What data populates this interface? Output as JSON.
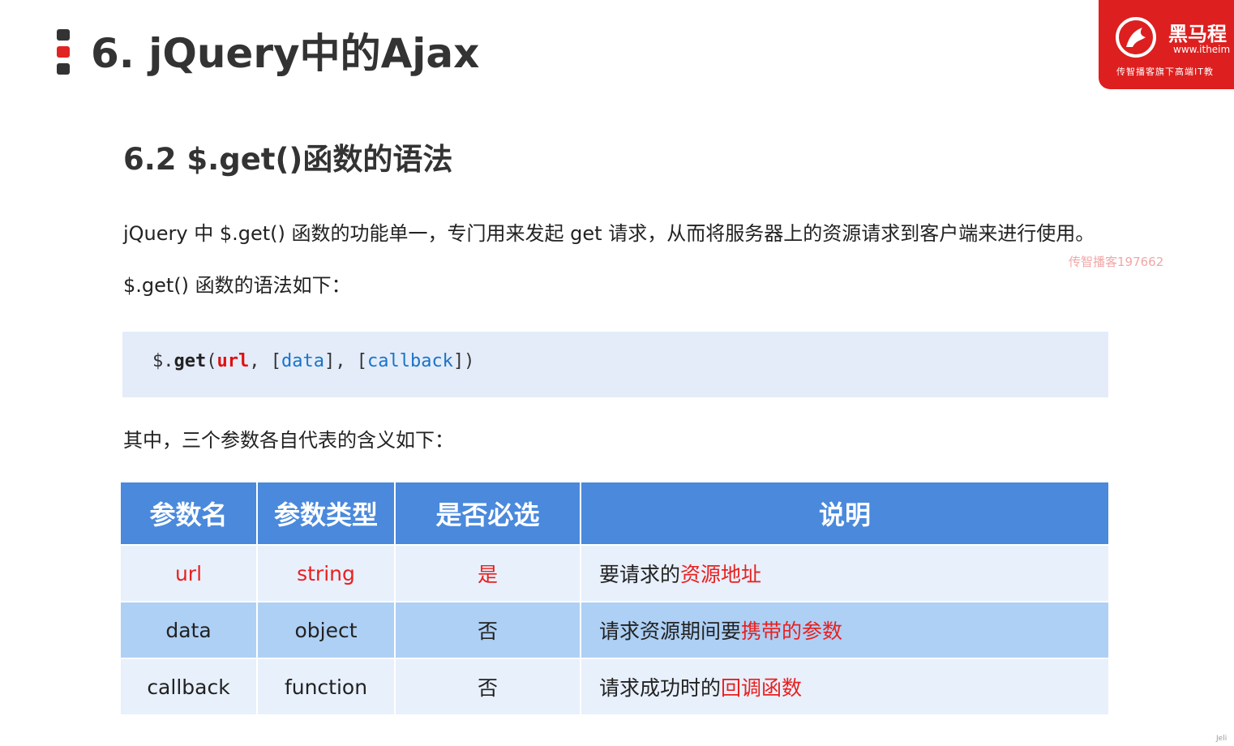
{
  "header": {
    "title": "6. jQuery中的Ajax"
  },
  "logo": {
    "name": "黑马程",
    "url": "www.itheim",
    "tagline": "传智播客旗下高端IT教"
  },
  "section": {
    "subtitle": "6.2 $.get()函数的语法",
    "intro": "jQuery 中 $.get() 函数的功能单一，专门用来发起 get 请求，从而将服务器上的资源请求到客户端来进行使用。",
    "watermark": "传智播客197662",
    "syntax_intro": "$.get() 函数的语法如下：",
    "params_intro": "其中，三个参数各自代表的含义如下："
  },
  "code": {
    "prefix": "$.",
    "method": "get",
    "open_paren": "(",
    "required_param": "url",
    "sep1": ", [",
    "opt_param1": "data",
    "sep2": "], [",
    "opt_param2": "callback",
    "close": "])"
  },
  "table": {
    "headers": [
      "参数名",
      "参数类型",
      "是否必选",
      "说明"
    ],
    "rows": [
      {
        "name": "url",
        "type": "string",
        "required": "是",
        "desc_plain": "要请求的",
        "desc_highlight": "资源地址"
      },
      {
        "name": "data",
        "type": "object",
        "required": "否",
        "desc_plain": "请求资源期间要",
        "desc_highlight": "携带的参数"
      },
      {
        "name": "callback",
        "type": "function",
        "required": "否",
        "desc_plain": "请求成功时的",
        "desc_highlight": "回调函数"
      }
    ]
  },
  "colors": {
    "accent_red": "#e82020",
    "header_blue": "#4a89dc",
    "row_light": "#e8f0fb",
    "row_dark": "#aed0f5",
    "code_bg": "#e4ecf9"
  },
  "corner_text": "Jeli"
}
